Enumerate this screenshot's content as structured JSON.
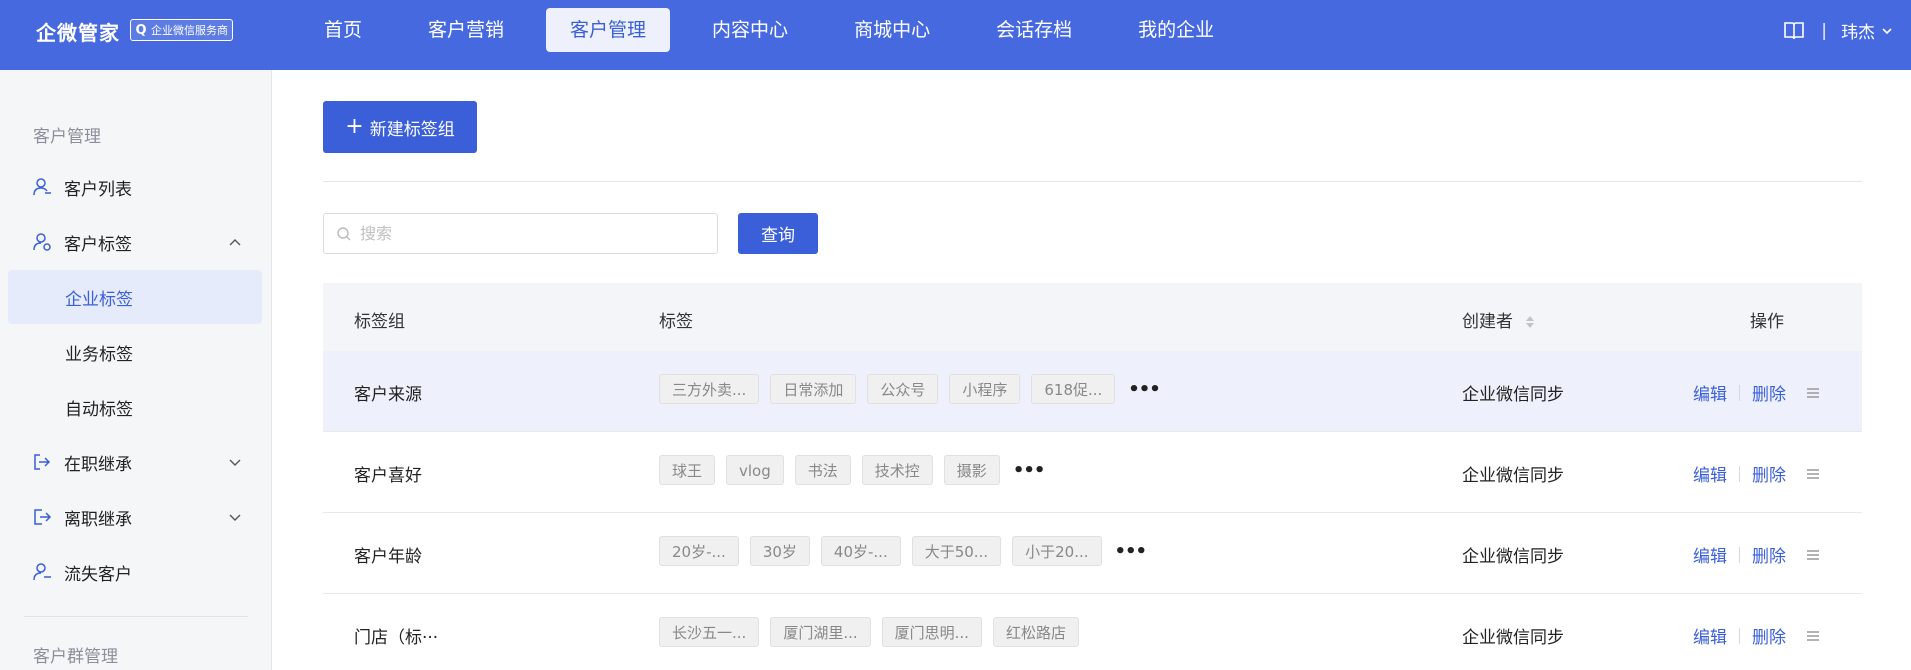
{
  "header": {
    "logo": "企微管家",
    "logo_badge": "企业微信服务商",
    "nav": [
      "首页",
      "客户营销",
      "客户管理",
      "内容中心",
      "商城中心",
      "会话存档",
      "我的企业"
    ],
    "active_nav": 2,
    "separator": "|",
    "user": "玮杰"
  },
  "sidebar": {
    "section1_title": "客户管理",
    "items": [
      {
        "label": "客户列表",
        "icon": "user-icon"
      },
      {
        "label": "客户标签",
        "icon": "user-tag-icon",
        "expanded": true
      },
      {
        "label": "企业标签",
        "sub": true,
        "active": true
      },
      {
        "label": "业务标签",
        "sub": true
      },
      {
        "label": "自动标签",
        "sub": true
      },
      {
        "label": "在职继承",
        "icon": "transfer-in-icon"
      },
      {
        "label": "离职继承",
        "icon": "transfer-out-icon"
      },
      {
        "label": "流失客户",
        "icon": "user-lost-icon"
      }
    ],
    "section2_title": "客户群管理"
  },
  "toolbar": {
    "new_group_label": "新建标签组",
    "search_placeholder": "搜索",
    "query_label": "查询"
  },
  "table": {
    "columns": [
      "标签组",
      "标签",
      "创建者",
      "操作"
    ],
    "rows": [
      {
        "group": "客户来源",
        "tags": [
          "三方外卖...",
          "日常添加",
          "公众号",
          "小程序",
          "618促..."
        ],
        "creator": "企业微信同步"
      },
      {
        "group": "客户喜好",
        "tags": [
          "球王",
          "vlog",
          "书法",
          "技术控",
          "摄影"
        ],
        "creator": "企业微信同步"
      },
      {
        "group": "客户年龄",
        "tags": [
          "20岁-...",
          "30岁",
          "40岁-...",
          "大于50...",
          "小于20..."
        ],
        "creator": "企业微信同步"
      },
      {
        "group": "门店（标···",
        "tags": [
          "长沙五一...",
          "厦门湖里...",
          "厦门思明...",
          "红松路店"
        ],
        "creator": "企业微信同步"
      }
    ],
    "edit_label": "编辑",
    "delete_label": "删除",
    "more_label": "•••"
  },
  "colors": {
    "primary": "#3a5fd9",
    "topbar": "#4669e0",
    "sidebar_bg": "#f5f6f8",
    "row_highlight": "#eef1fb"
  }
}
